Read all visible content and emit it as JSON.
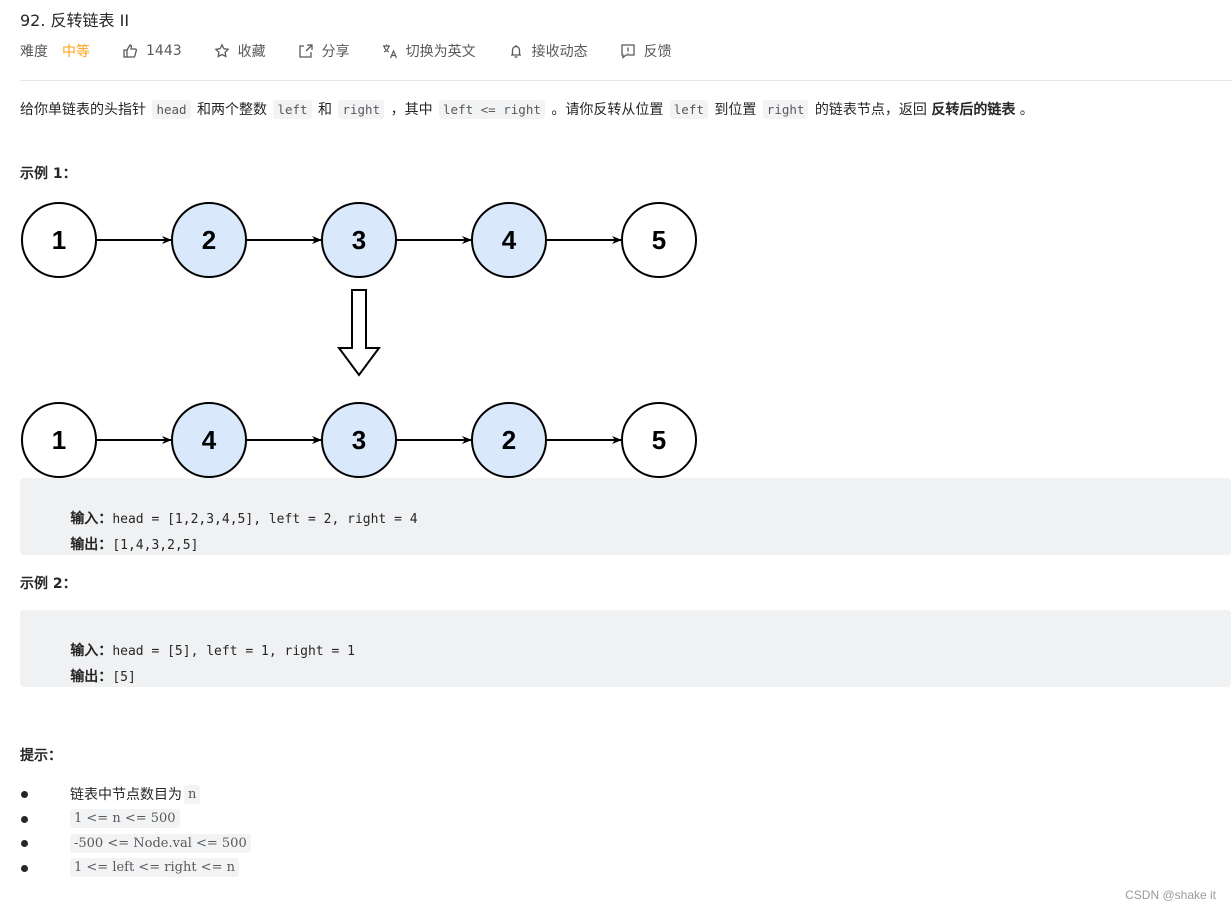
{
  "problem": {
    "title": "92. 反转链表 II",
    "difficulty_label": "难度",
    "difficulty_value": "中等",
    "difficulty_color": "#ffa116"
  },
  "toolbar": [
    {
      "icon": "thumbs-up-icon",
      "label": "1443"
    },
    {
      "icon": "star-icon",
      "label": "收藏"
    },
    {
      "icon": "share-icon",
      "label": "分享"
    },
    {
      "icon": "translate-icon",
      "label": "切换为英文"
    },
    {
      "icon": "bell-icon",
      "label": "接收动态"
    },
    {
      "icon": "feedback-icon",
      "label": "反馈"
    }
  ],
  "description": {
    "t1": "给你单链表的头指针",
    "c1": "head",
    "t2": "和两个整数",
    "c2": "left",
    "t3": "和",
    "c3": "right",
    "t4": "，其中",
    "c4": "left <= right",
    "t5": "。请你反转从位置",
    "c5": "left",
    "t6": "到位置",
    "c6": "right",
    "t7": "的链表节点，返回",
    "bold": "反转后的链表",
    "t8": "。"
  },
  "example1": {
    "heading": "示例 1：",
    "before_nodes": [
      "1",
      "2",
      "3",
      "4",
      "5"
    ],
    "after_nodes": [
      "1",
      "4",
      "3",
      "2",
      "5"
    ],
    "highlighted_indices": [
      1,
      2,
      3
    ],
    "node_fill": "#dae8fc",
    "input_label": "输入：",
    "input_value": "head = [1,2,3,4,5], left = 2, right = 4",
    "output_label": "输出：",
    "output_value": "[1,4,3,2,5]"
  },
  "example2": {
    "heading": "示例 2：",
    "input_label": "输入：",
    "input_value": "head = [5], left = 1, right = 1",
    "output_label": "输出：",
    "output_value": "[5]"
  },
  "hints": {
    "heading": "提示：",
    "item0_text": "链表中节点数目为",
    "item0_code": "n",
    "item1_code": "1 <= n <= 500",
    "item2_code": "-500 <= Node.val <= 500",
    "item3_code": "1 <= left <= right <= n"
  },
  "watermark": "CSDN @shake it"
}
